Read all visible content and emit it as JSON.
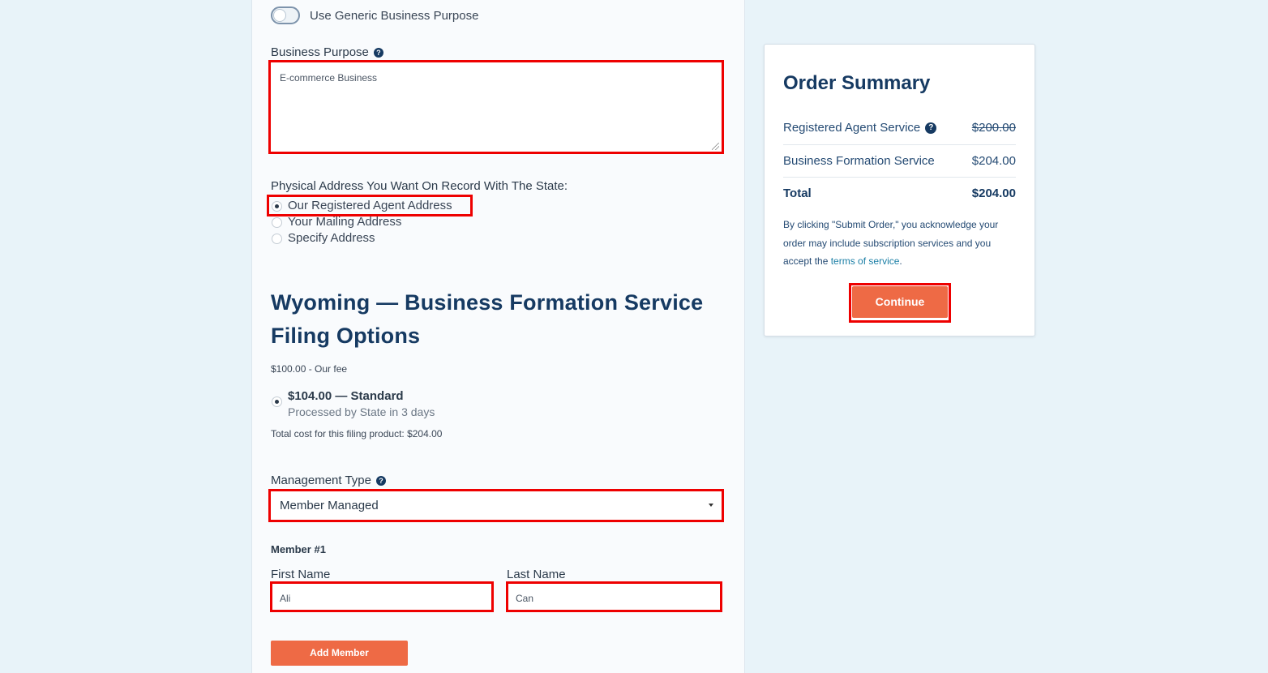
{
  "form": {
    "generic_purpose_toggle_label": "Use Generic Business Purpose",
    "business_purpose_label": "Business Purpose",
    "business_purpose_value": "E-commerce Business",
    "address_question": "Physical Address You Want On Record With The State:",
    "address_options": [
      {
        "label": "Our Registered Agent Address",
        "selected": true
      },
      {
        "label": "Your Mailing Address",
        "selected": false
      },
      {
        "label": "Specify Address",
        "selected": false
      }
    ],
    "section_title_line1": "Wyoming — Business Formation Service",
    "section_title_line2": "Filing Options",
    "our_fee": "$100.00 - Our fee",
    "filing_option_title": "$104.00 — Standard",
    "filing_option_subtitle": "Processed by State in 3 days",
    "total_cost": "Total cost for this filing product: $204.00",
    "management_type_label": "Management Type",
    "management_type_value": "Member Managed",
    "member_heading": "Member #1",
    "first_name_label": "First Name",
    "first_name_value": "Ali",
    "last_name_label": "Last Name",
    "last_name_value": "Can",
    "add_member_label": "Add Member"
  },
  "summary": {
    "title": "Order Summary",
    "rows": [
      {
        "label": "Registered Agent Service",
        "price": "$200.00",
        "strikethrough": true
      },
      {
        "label": "Business Formation Service",
        "price": "$204.00",
        "strikethrough": false
      }
    ],
    "total_label": "Total",
    "total_price": "$204.00",
    "terms_prefix": "By clicking \"Submit Order,\" you acknowledge your order may include subscription services and you accept the ",
    "terms_link": "terms of service",
    "terms_suffix": ".",
    "continue_label": "Continue"
  },
  "colors": {
    "accent_orange": "#ee6a45",
    "heading_navy": "#163a62",
    "highlight_red": "#ee0000",
    "page_background": "#e8f3f9"
  }
}
